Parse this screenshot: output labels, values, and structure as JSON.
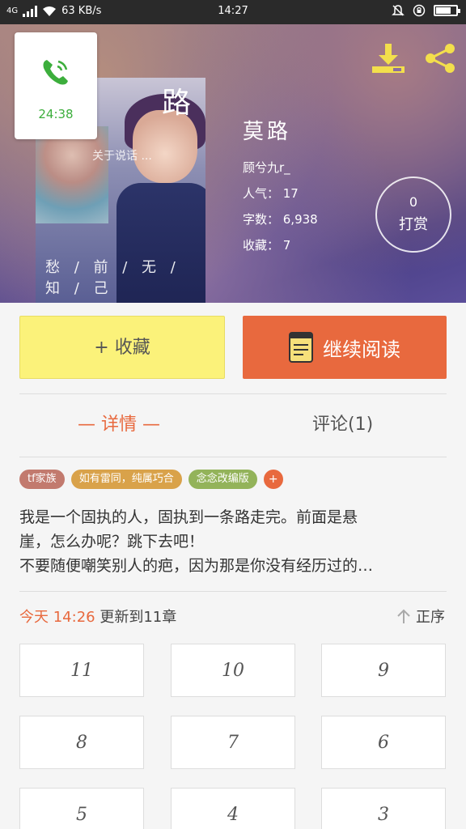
{
  "status_bar": {
    "network": "4G",
    "speed": "63 KB/s",
    "time": "14:27"
  },
  "call": {
    "duration": "24:38"
  },
  "cover": {
    "title": "路",
    "mid_text": "关于说话 ...",
    "bottom_text": "愁 / 前 / 无 / 知 / 己"
  },
  "book": {
    "name": "莫路",
    "author": "顾兮九r_",
    "popularity": "人气： 17",
    "word_count": "字数： 6,938",
    "favorites": "收藏： 7"
  },
  "reward": {
    "count": "0",
    "label": "打赏"
  },
  "actions": {
    "favorite_label": "+ 收藏",
    "continue_label": "继续阅读"
  },
  "tabs": {
    "detail": "— 详情 —",
    "comments": "评论(1)"
  },
  "tags": [
    {
      "label": "tf家族",
      "color": "#c27a6e"
    },
    {
      "label": "如有雷同，纯属巧合",
      "color": "#d9a24a"
    },
    {
      "label": "念念改编版",
      "color": "#93b35a"
    },
    {
      "label": "+",
      "color": "#e8693e"
    }
  ],
  "description": {
    "line1": "我是一个固执的人，固执到一条路走完。前面是悬",
    "line2": "崖，怎么办呢？跳下去吧！",
    "line3": "不要随便嘲笑别人的疤，因为那是你没有经历过的…"
  },
  "update": {
    "today": "今天 14:26",
    "text": " 更新到11章"
  },
  "sort": {
    "label": "正序"
  },
  "chapters": [
    "11",
    "10",
    "9",
    "8",
    "7",
    "6",
    "5",
    "4",
    "3"
  ]
}
